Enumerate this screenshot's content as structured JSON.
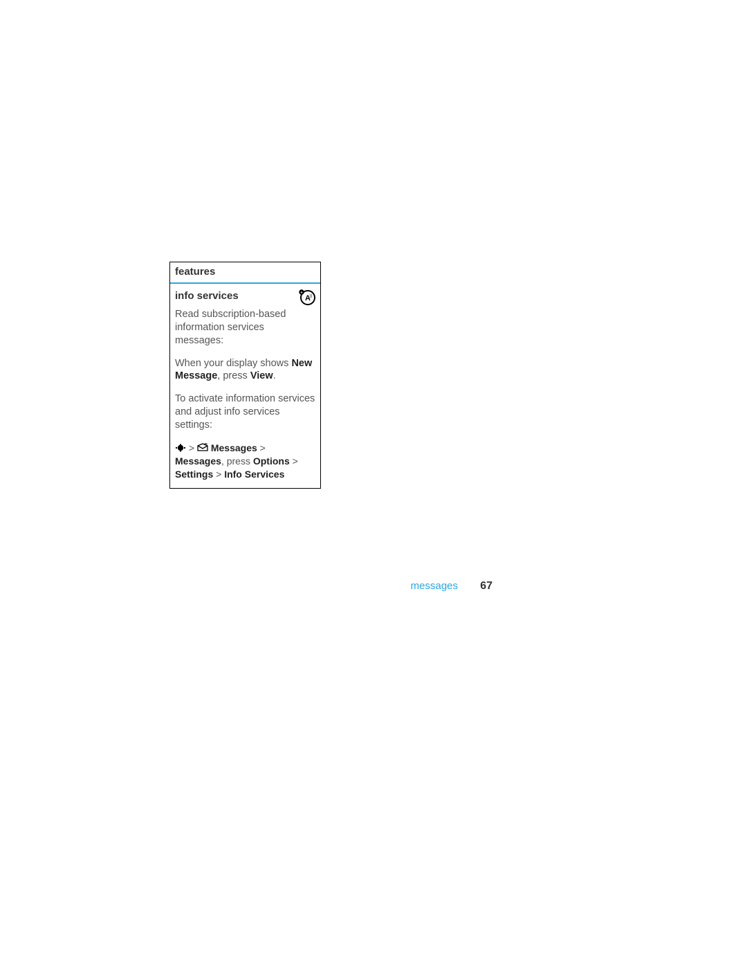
{
  "box": {
    "header": "features",
    "subhead": "info services",
    "p1": "Read subscription-based information services messages:",
    "p2_a": "When your display shows ",
    "p2_b_bold": "New Message",
    "p2_c": ", press ",
    "p2_d_bold": "View",
    "p2_e": ".",
    "p3": "To activate information services and adjust info services settings:",
    "nav": {
      "gt1": " > ",
      "seg1": "Messages",
      "gt2": " > ",
      "seg2": "Messages",
      "press_label": ", press ",
      "seg3": "Options",
      "gt3": " > ",
      "seg4": "Settings",
      "gt4": " > ",
      "seg5": "Info Services"
    }
  },
  "footer": {
    "section": "messages",
    "page": "67"
  }
}
